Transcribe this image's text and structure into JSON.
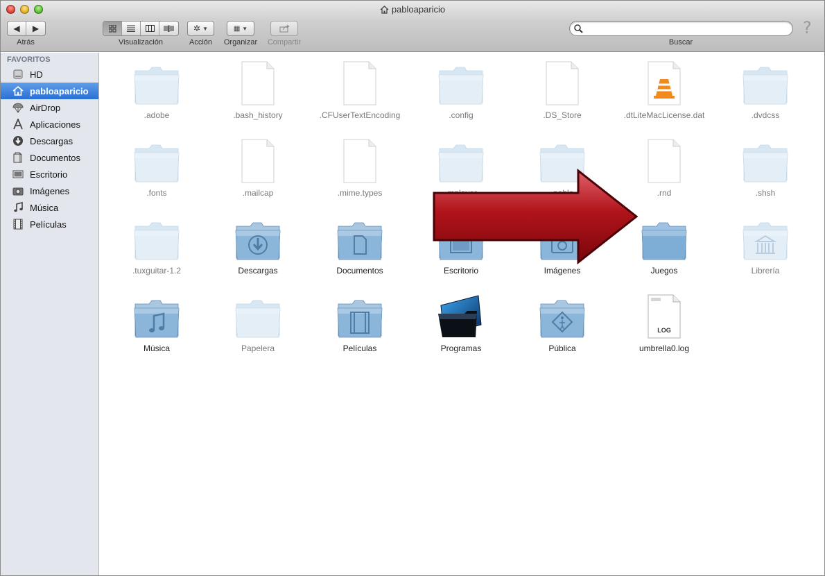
{
  "window": {
    "title": "pabloaparicio"
  },
  "toolbar": {
    "back_label": "Atrás",
    "view_label": "Visualización",
    "action_label": "Acción",
    "arrange_label": "Organizar",
    "share_label": "Compartir",
    "search_label": "Buscar",
    "search_placeholder": "",
    "help_glyph": "?"
  },
  "sidebar": {
    "heading": "FAVORITOS",
    "items": [
      {
        "label": "HD",
        "icon": "hard-drive-icon"
      },
      {
        "label": "pabloaparicio",
        "icon": "home-icon",
        "selected": true
      },
      {
        "label": "AirDrop",
        "icon": "airdrop-icon"
      },
      {
        "label": "Aplicaciones",
        "icon": "applications-icon"
      },
      {
        "label": "Descargas",
        "icon": "download-icon"
      },
      {
        "label": "Documentos",
        "icon": "document-icon"
      },
      {
        "label": "Escritorio",
        "icon": "desktop-icon"
      },
      {
        "label": "Imágenes",
        "icon": "camera-icon"
      },
      {
        "label": "Música",
        "icon": "music-note-icon"
      },
      {
        "label": "Películas",
        "icon": "film-icon"
      }
    ]
  },
  "files": [
    {
      "name": ".adobe",
      "kind": "folder",
      "dim": true
    },
    {
      "name": ".bash_history",
      "kind": "doc",
      "dim": true
    },
    {
      "name": ".CFUserTextEncoding",
      "kind": "doc",
      "dim": true
    },
    {
      "name": ".config",
      "kind": "folder",
      "dim": true
    },
    {
      "name": ".DS_Store",
      "kind": "doc",
      "dim": true
    },
    {
      "name": ".dtLiteMacLicense.dat",
      "kind": "vlc",
      "dim": true
    },
    {
      "name": ".dvdcss",
      "kind": "folder",
      "dim": true
    },
    {
      "name": ".fonts",
      "kind": "folder",
      "dim": true
    },
    {
      "name": ".mailcap",
      "kind": "doc",
      "dim": true
    },
    {
      "name": ".mime.types",
      "kind": "doc",
      "dim": true
    },
    {
      "name": ".mplayer",
      "kind": "folder",
      "dim": true
    },
    {
      "name": ".pablo",
      "kind": "folder",
      "dim": true
    },
    {
      "name": ".rnd",
      "kind": "doc",
      "dim": true
    },
    {
      "name": ".shsh",
      "kind": "folder",
      "dim": true
    },
    {
      "name": ".tuxguitar-1.2",
      "kind": "folder",
      "dim": true
    },
    {
      "name": "Descargas",
      "kind": "folder-download",
      "dim": false
    },
    {
      "name": "Documentos",
      "kind": "folder-document",
      "dim": false
    },
    {
      "name": "Escritorio",
      "kind": "folder-desktop",
      "dim": false
    },
    {
      "name": "Imágenes",
      "kind": "folder-camera",
      "dim": false
    },
    {
      "name": "Juegos",
      "kind": "folder",
      "dim": false,
      "strong": true
    },
    {
      "name": "Librería",
      "kind": "folder-library",
      "dim": true
    },
    {
      "name": "Música",
      "kind": "folder-music",
      "dim": false
    },
    {
      "name": "Papelera",
      "kind": "folder",
      "dim": true
    },
    {
      "name": "Películas",
      "kind": "folder-film",
      "dim": false
    },
    {
      "name": "Programas",
      "kind": "folder-programs",
      "dim": false
    },
    {
      "name": "Pública",
      "kind": "folder-public",
      "dim": false
    },
    {
      "name": "umbrella0.log",
      "kind": "log",
      "dim": false,
      "badge": "LOG"
    }
  ],
  "colors": {
    "selection": "#2a6fd6",
    "folder": "#a9c7e0",
    "arrow": "#b0141a"
  }
}
